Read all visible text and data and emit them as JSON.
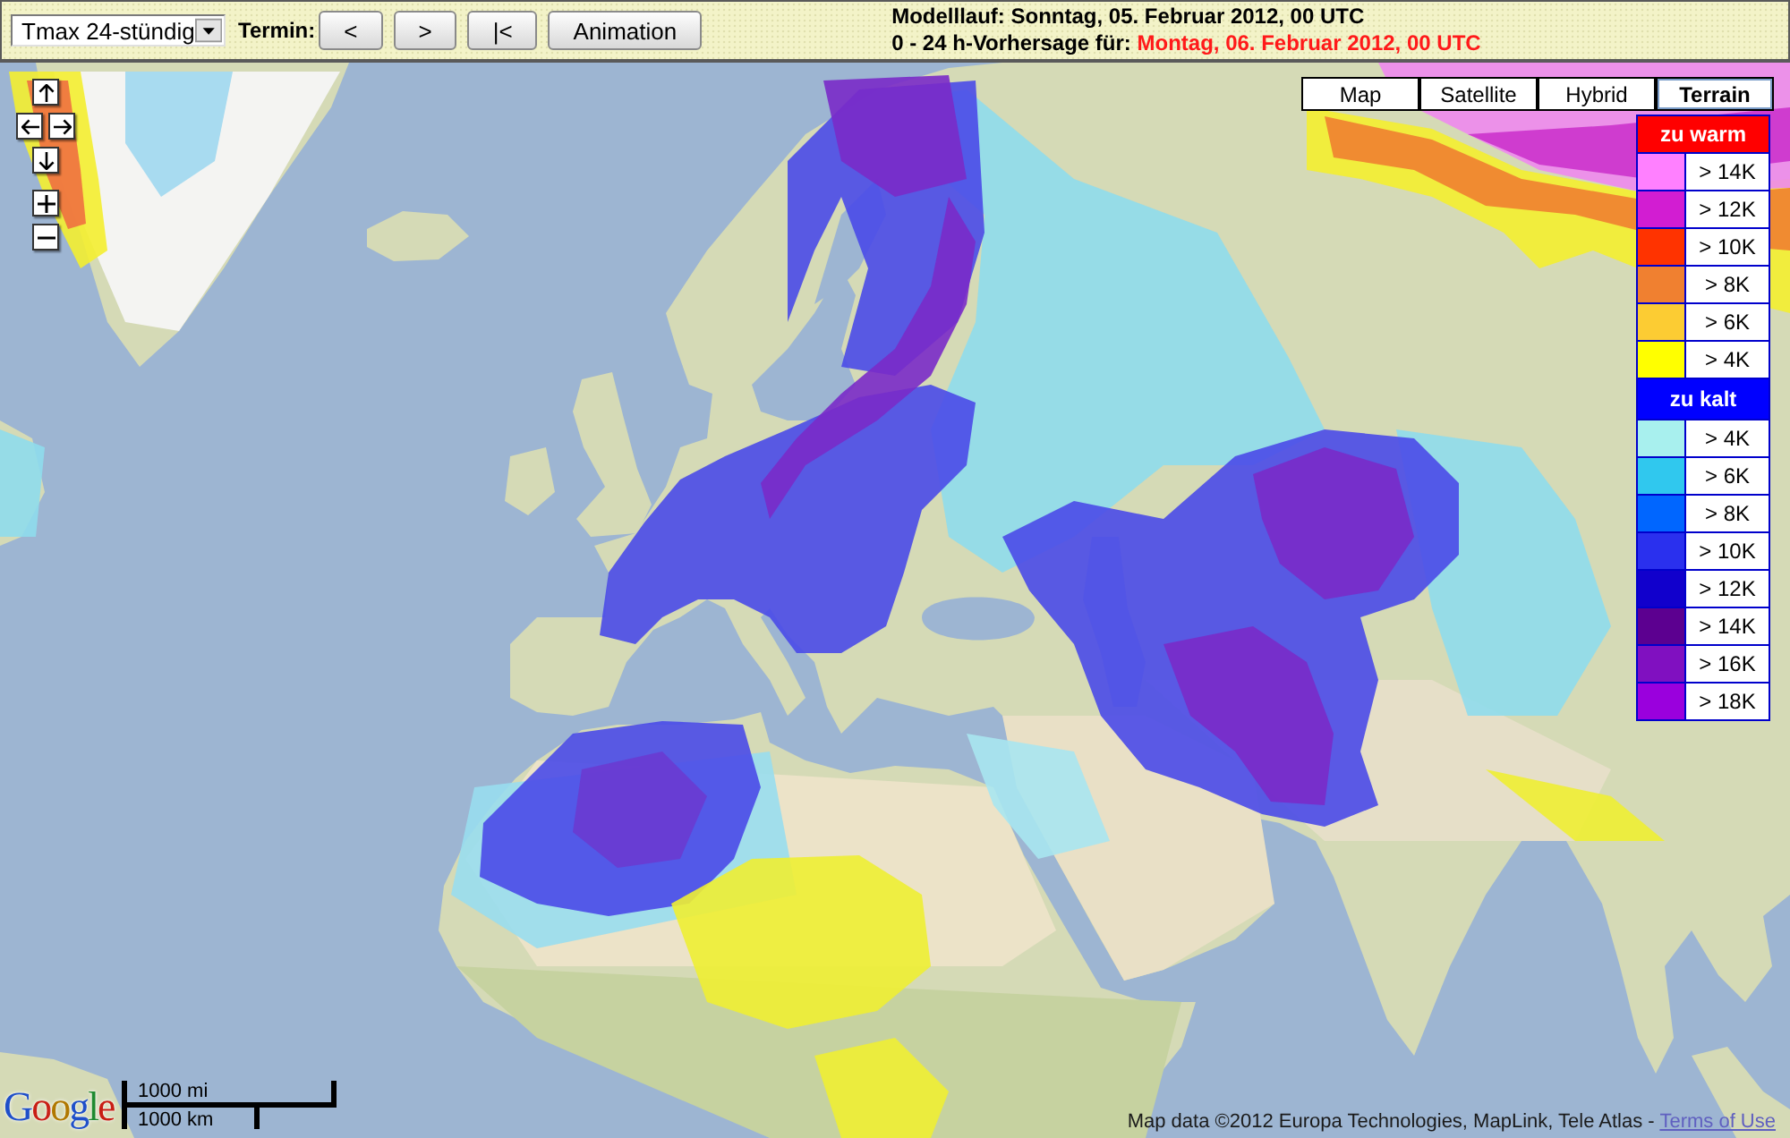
{
  "toolbar": {
    "product_select": {
      "value": "Tmax 24-stündig"
    },
    "termin_label": "Termin:",
    "buttons": [
      {
        "label": "<"
      },
      {
        "label": ">"
      },
      {
        "label": "|<"
      },
      {
        "label": "Animation"
      }
    ],
    "model_run": "Modelllauf: Sonntag, 05. Februar 2012, 00 UTC",
    "forecast": {
      "label": "0 - 24 h-Vorhersage für:",
      "value": "Montag, 06. Februar 2012, 00 UTC"
    }
  },
  "map": {
    "map_types": [
      {
        "label": "Map",
        "selected": false
      },
      {
        "label": "Satellite",
        "selected": false
      },
      {
        "label": "Hybrid",
        "selected": false
      },
      {
        "label": "Terrain",
        "selected": true
      }
    ],
    "legend": {
      "groups": [
        {
          "title": "zu warm",
          "color": "#ff0000",
          "items": [
            {
              "label": "> 14K",
              "color": "#ff80ff"
            },
            {
              "label": "> 12K",
              "color": "#d21dd2"
            },
            {
              "label": "> 10K",
              "color": "#ff3300"
            },
            {
              "label": "> 8K",
              "color": "#f08030"
            },
            {
              "label": "> 6K",
              "color": "#fccc33"
            },
            {
              "label": "> 4K",
              "color": "#ffff00"
            }
          ]
        },
        {
          "title": "zu kalt",
          "color": "#0000ff",
          "items": [
            {
              "label": "> 4K",
              "color": "#a8f0ee"
            },
            {
              "label": "> 6K",
              "color": "#30c8ee"
            },
            {
              "label": "> 8K",
              "color": "#0066ff"
            },
            {
              "label": "> 10K",
              "color": "#2a30ee"
            },
            {
              "label": "> 12K",
              "color": "#1100cc"
            },
            {
              "label": "> 14K",
              "color": "#5c0090"
            },
            {
              "label": "> 16K",
              "color": "#8010c0"
            },
            {
              "label": "> 18K",
              "color": "#9a00dd"
            }
          ]
        }
      ]
    },
    "scale": {
      "miles": "1000 mi",
      "km": "1000 km"
    },
    "logo": "Google",
    "attribution": {
      "text": "Map data ©2012 Europa Technologies, MapLink, Tele Atlas -",
      "link": "Terms of Use"
    }
  }
}
